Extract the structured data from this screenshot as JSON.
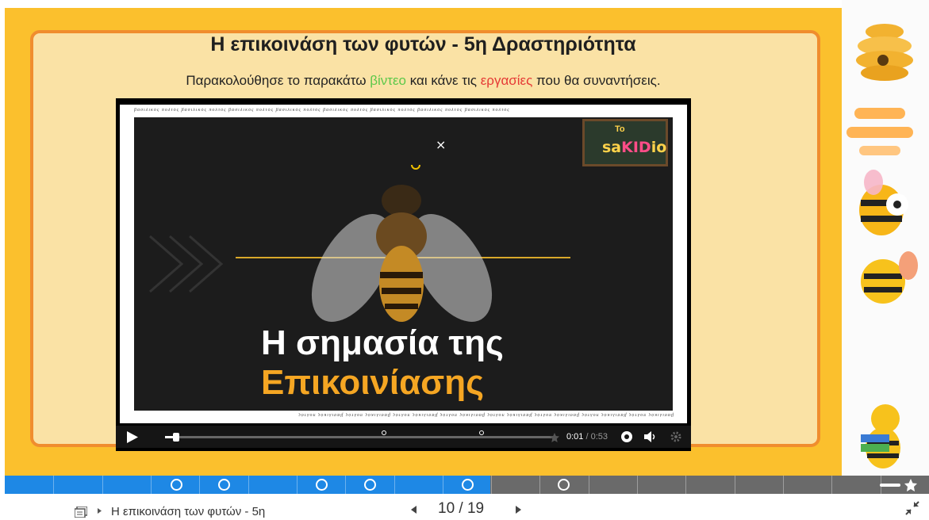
{
  "slide": {
    "title": "Η επικοινάση των φυτών - 5η Δραστηριότητα",
    "instruction_part1": "Παρακολούθησε το παρακάτω ",
    "instruction_link1": "βίντεο",
    "instruction_part2": " και κάνε τις ",
    "instruction_link2": "εργασίες",
    "instruction_part3": " που θα συναντήσεις."
  },
  "video": {
    "heading_line1": "Η σημασία της",
    "heading_line2": "Επικοινίασης",
    "logo_to": "To",
    "logo_left": "sa",
    "logo_mid": "KID",
    "logo_right": "io",
    "border_text": "βασιλικός πολτός  βασιλικός πολτός  βασιλικός πολτός  βασιλικός πολτός  βασιλικός πολτός  βασιλικός πολτός  βασιλικός πολτός  βασιλικός πολτός",
    "current_time": "0:01",
    "duration": " / 0:53",
    "played_fraction": 0.02
  },
  "progress": {
    "filled_fraction": 0.525,
    "segments": 19
  },
  "footer": {
    "breadcrumb": "Η επικοινάση των φυτών - 5η",
    "page_current": "10",
    "page_sep": "/",
    "page_total": "19"
  },
  "colors": {
    "accent": "#1e88e5",
    "slide_bg": "#fbc02d",
    "panel_bg": "#fae2a5",
    "panel_border": "#f08d2e"
  }
}
